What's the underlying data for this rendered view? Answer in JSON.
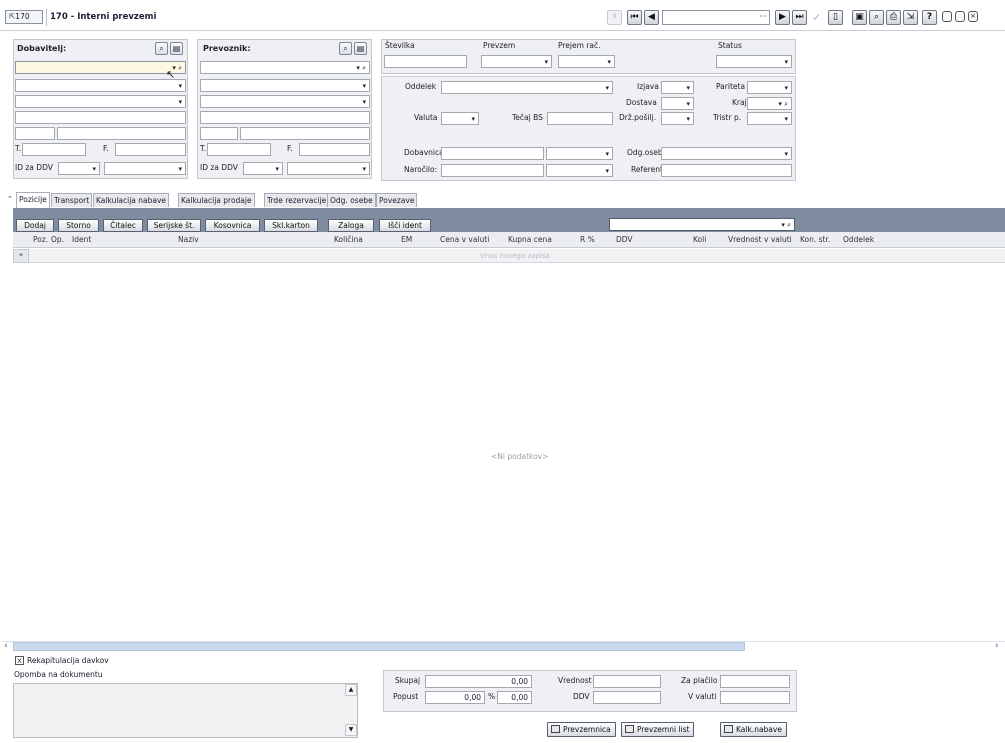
{
  "window": {
    "id_badge": "170",
    "title": "170 - Interni prevzemi",
    "record_field": "···"
  },
  "dobavitelj": {
    "label": "Dobavitelj:",
    "t_label": "T.",
    "f_label": "F.",
    "ddv_label": "ID za DDV"
  },
  "prevoznik": {
    "label": "Prevoznik:",
    "t_label": "T.",
    "f_label": "F.",
    "ddv_label": "ID za DDV"
  },
  "header_fields": {
    "stevilka": "Številka",
    "prevzem": "Prevzem",
    "prejem_rac": "Prejem rač.",
    "status": "Status"
  },
  "mid_fields": {
    "oddelek": "Oddelek",
    "izjava": "Izjava",
    "pariteta": "Pariteta",
    "dostava": "Dostava",
    "kraj": "Kraj",
    "valuta": "Valuta",
    "tecaj_bs": "Tečaj BS",
    "drz_poslji": "Drž.pošilj.",
    "tristr_p": "Tristr p.",
    "dobavnica": "Dobavnica:",
    "odg_oseba": "Odg.oseba",
    "narocilo": "Naročilo:",
    "referent": "Referent"
  },
  "tabs": [
    "Pozicije",
    "Transport",
    "Kalkulacija nabave",
    "Kalkulacija prodaje",
    "Trde rezervacije",
    "Odg. osebe",
    "Povezave"
  ],
  "toolbar": [
    "Dodaj",
    "Storno",
    "Čitalec",
    "Serijske št.",
    "Kosovnica",
    "Skl.karton",
    "Zaloga",
    "Išči ident"
  ],
  "grid": {
    "columns": [
      "Poz.",
      "Op.",
      "Ident",
      "Naziv",
      "Količina",
      "EM",
      "Cena v valuti",
      "Kupna cena",
      "R %",
      "DDV",
      "Koli",
      "Vrednost v valuti",
      "Kon. str.",
      "Oddelek"
    ],
    "new_row": "Vnos novega zapisa",
    "empty": "<Ni podatkov>",
    "row_marker": "*"
  },
  "recap": {
    "label": "Rekapitulacija davkov",
    "checkbox": "X"
  },
  "note": {
    "label": "Opomba na dokumentu"
  },
  "totals": {
    "skupaj_label": "Skupaj",
    "skupaj": "0,00",
    "popust_label": "Popust",
    "popust": "0,00",
    "pct": "%",
    "popust_val": "0,00",
    "vrednost_label": "Vrednost",
    "ddv_label": "DDV",
    "za_placilo_label": "Za plačilo",
    "v_valuti_label": "V valuti"
  },
  "print_buttons": [
    "Prevzemnica",
    "Prevzemni list",
    "Kalk.nabave"
  ]
}
